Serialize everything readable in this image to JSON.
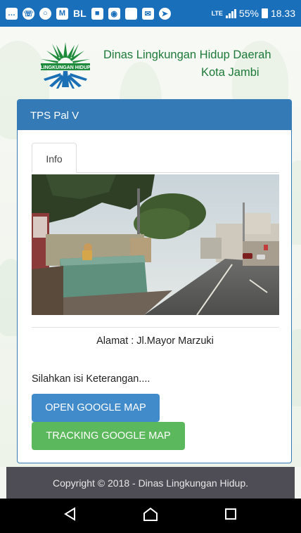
{
  "statusbar": {
    "icons": [
      "message-icon",
      "whatsapp-icon",
      "chrome-icon",
      "gmail-icon",
      "bbm-icon",
      "briefcase-icon",
      "app-icon",
      "square-icon",
      "mail-icon",
      "location-icon"
    ],
    "bl_label": "BL",
    "network": "LTE",
    "battery": "55%",
    "time": "18.33"
  },
  "header": {
    "logo_text": "LINGKUNGAN HIDUP",
    "agency": "Dinas Lingkungan Hidup Daerah",
    "city": "Kota Jambi"
  },
  "panel": {
    "title": "TPS Pal V",
    "tab": "Info",
    "address_label": "Alamat :",
    "address_value": "Jl.Mayor Marzuki",
    "note": "Silahkan isi Keterangan....",
    "open_map": "OPEN GOOGLE MAP",
    "track_map": "TRACKING GOOGLE MAP"
  },
  "footer": {
    "copyright": "Copyright © 2018 - Dinas Lingkungan Hidup."
  },
  "colors": {
    "primary": "#337ab7",
    "open_button": "#428bca",
    "track_button": "#5cb85c",
    "agency_text": "#1d7a3a",
    "footer_bg": "#4e4d55"
  }
}
